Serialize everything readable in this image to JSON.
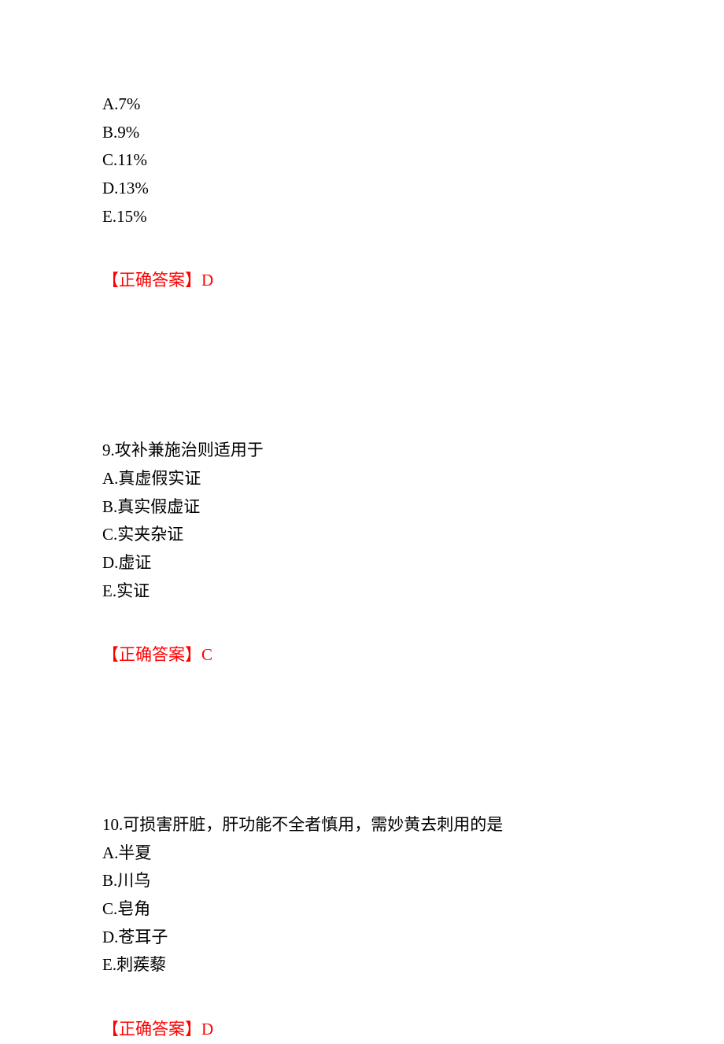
{
  "questions": [
    {
      "options": [
        {
          "label": "A.",
          "text": "7%"
        },
        {
          "label": "B.",
          "text": "9%"
        },
        {
          "label": "C.",
          "text": "11%"
        },
        {
          "label": "D.",
          "text": "13%"
        },
        {
          "label": "E.",
          "text": "15%"
        }
      ],
      "answer_label": "【正确答案】",
      "answer_value": "D"
    },
    {
      "number": "9.",
      "stem": "攻补兼施治则适用于",
      "options": [
        {
          "label": "A.",
          "text": "真虚假实证"
        },
        {
          "label": "B.",
          "text": "真实假虚证"
        },
        {
          "label": "C.",
          "text": "实夹杂证"
        },
        {
          "label": "D.",
          "text": "虚证"
        },
        {
          "label": "E.",
          "text": "实证"
        }
      ],
      "answer_label": "【正确答案】",
      "answer_value": "C"
    },
    {
      "number": "10.",
      "stem": "可损害肝脏，肝功能不全者慎用，需妙黄去刺用的是",
      "options": [
        {
          "label": "A.",
          "text": "半夏"
        },
        {
          "label": "B.",
          "text": "川乌"
        },
        {
          "label": "C.",
          "text": "皂角"
        },
        {
          "label": "D.",
          "text": "苍耳子"
        },
        {
          "label": "E.",
          "text": "刺蒺藜"
        }
      ],
      "answer_label": "【正确答案】",
      "answer_value": "D"
    }
  ]
}
